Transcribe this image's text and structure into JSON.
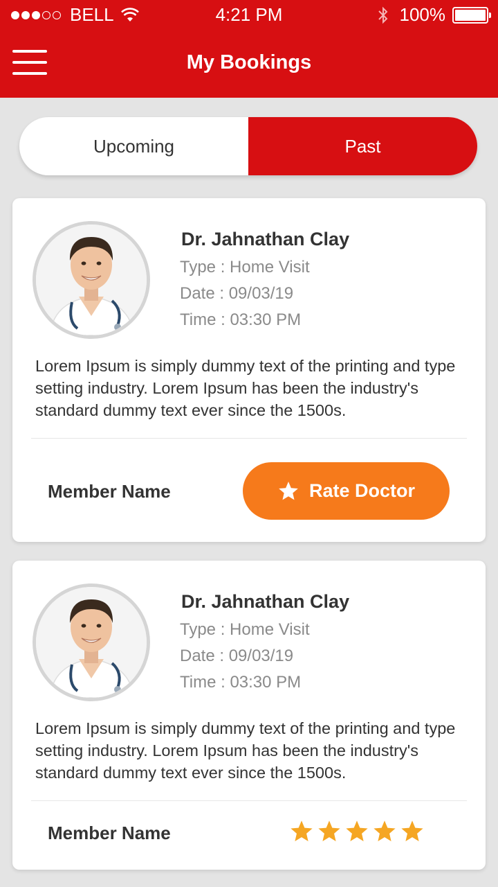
{
  "status_bar": {
    "carrier": "BELL",
    "time": "4:21 PM",
    "battery": "100%",
    "signal_filled": 3,
    "signal_total": 5
  },
  "header": {
    "title": "My Bookings",
    "menu_icon": "hamburger-menu-icon"
  },
  "tabs": [
    {
      "label": "Upcoming",
      "active": false
    },
    {
      "label": "Past",
      "active": true
    }
  ],
  "bookings": [
    {
      "doctor_name": "Dr. Jahnathan Clay",
      "type": "Type : Home Visit",
      "date": "Date : 09/03/19",
      "time": "Time : 03:30 PM",
      "description": "Lorem Ipsum is simply dummy text of the printing and type setting industry. Lorem Ipsum has been the industry's standard dummy text ever since the 1500s.",
      "member_label": "Member Name",
      "action_label": "Rate Doctor"
    },
    {
      "doctor_name": "Dr. Jahnathan Clay",
      "type": "Type : Home Visit",
      "date": "Date : 09/03/19",
      "time": "Time : 03:30 PM",
      "description": "Lorem Ipsum is simply dummy text of the printing and type setting industry. Lorem Ipsum has been the industry's standard dummy text ever since the 1500s.",
      "member_label": "Member Name",
      "rating": 5
    }
  ],
  "colors": {
    "brand_red": "#d70f12",
    "accent_orange": "#f67a1b",
    "star_color": "#f5a623"
  }
}
